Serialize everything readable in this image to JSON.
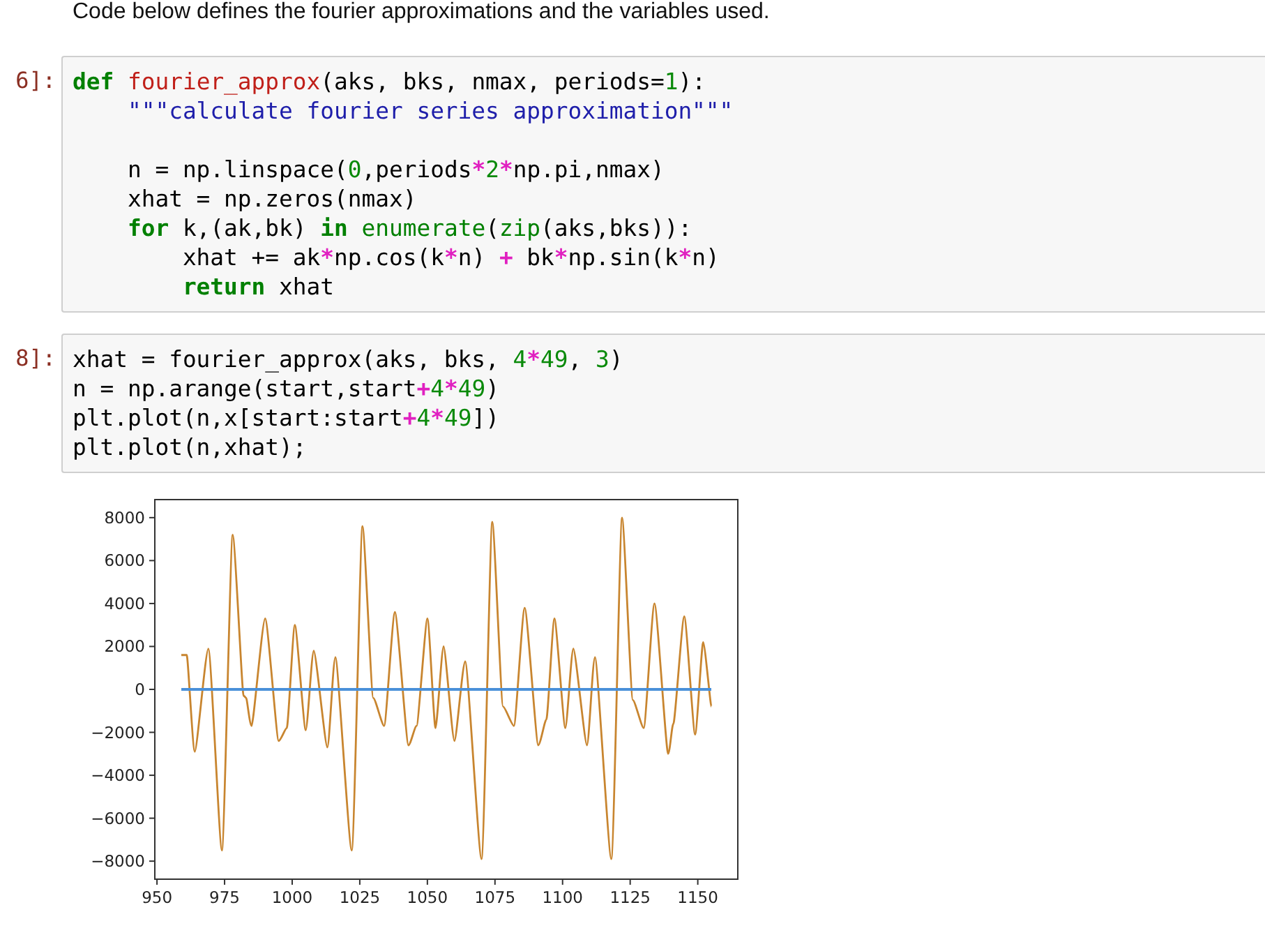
{
  "intro": "Code below defines the fourier approximations and the variables used.",
  "cells": [
    {
      "prompt": "6]:",
      "lines": [
        {
          "tokens": [
            {
              "kind": "kw",
              "text": "def "
            },
            {
              "kind": "fn",
              "text": "fourier_approx"
            },
            {
              "kind": "plain",
              "text": "(aks, bks, nmax, periods="
            },
            {
              "kind": "num",
              "text": "1"
            },
            {
              "kind": "plain",
              "text": "):"
            }
          ]
        },
        {
          "tokens": [
            {
              "kind": "str",
              "text": "    \"\"\"calculate fourier series approximation\"\"\""
            }
          ]
        },
        {
          "kind": "blank"
        },
        {
          "tokens": [
            {
              "kind": "plain",
              "text": "    n = np.linspace("
            },
            {
              "kind": "num",
              "text": "0"
            },
            {
              "kind": "plain",
              "text": ",periods"
            },
            {
              "kind": "op",
              "text": "*"
            },
            {
              "kind": "num",
              "text": "2"
            },
            {
              "kind": "op",
              "text": "*"
            },
            {
              "kind": "plain",
              "text": "np.pi,nmax)"
            }
          ]
        },
        {
          "tokens": [
            {
              "kind": "plain",
              "text": "    xhat = np.zeros(nmax)"
            }
          ]
        },
        {
          "tokens": [
            {
              "kind": "kw",
              "text": "    for"
            },
            {
              "kind": "plain",
              "text": " k,(ak,bk) "
            },
            {
              "kind": "kw",
              "text": "in "
            },
            {
              "kind": "builtin",
              "text": "enumerate"
            },
            {
              "kind": "plain",
              "text": "("
            },
            {
              "kind": "builtin",
              "text": "zip"
            },
            {
              "kind": "plain",
              "text": "(aks,bks)):"
            }
          ]
        },
        {
          "tokens": [
            {
              "kind": "plain",
              "text": "        xhat += ak"
            },
            {
              "kind": "op",
              "text": "*"
            },
            {
              "kind": "plain",
              "text": "np.cos(k"
            },
            {
              "kind": "op",
              "text": "*"
            },
            {
              "kind": "plain",
              "text": "n) "
            },
            {
              "kind": "op",
              "text": "+"
            },
            {
              "kind": "plain",
              "text": " bk"
            },
            {
              "kind": "op",
              "text": "*"
            },
            {
              "kind": "plain",
              "text": "np.sin(k"
            },
            {
              "kind": "op",
              "text": "*"
            },
            {
              "kind": "plain",
              "text": "n)"
            }
          ]
        },
        {
          "tokens": [
            {
              "kind": "kw",
              "text": "        return"
            },
            {
              "kind": "plain",
              "text": " xhat"
            }
          ]
        }
      ]
    },
    {
      "prompt": "8]:",
      "lines": [
        {
          "tokens": [
            {
              "kind": "plain",
              "text": "xhat = fourier_approx(aks, bks, "
            },
            {
              "kind": "num",
              "text": "4"
            },
            {
              "kind": "op",
              "text": "*"
            },
            {
              "kind": "num",
              "text": "49"
            },
            {
              "kind": "plain",
              "text": ", "
            },
            {
              "kind": "num",
              "text": "3"
            },
            {
              "kind": "plain",
              "text": ")"
            }
          ]
        },
        {
          "tokens": [
            {
              "kind": "plain",
              "text": "n = np.arange(start,start"
            },
            {
              "kind": "op",
              "text": "+"
            },
            {
              "kind": "num",
              "text": "4"
            },
            {
              "kind": "op",
              "text": "*"
            },
            {
              "kind": "num",
              "text": "49"
            },
            {
              "kind": "plain",
              "text": ")"
            }
          ]
        },
        {
          "tokens": [
            {
              "kind": "plain",
              "text": "plt.plot(n,x[start:start"
            },
            {
              "kind": "op",
              "text": "+"
            },
            {
              "kind": "num",
              "text": "4"
            },
            {
              "kind": "op",
              "text": "*"
            },
            {
              "kind": "num",
              "text": "49"
            },
            {
              "kind": "plain",
              "text": "])"
            }
          ]
        },
        {
          "tokens": [
            {
              "kind": "plain",
              "text": "plt.plot(n,xhat);"
            }
          ]
        }
      ]
    }
  ],
  "output": {
    "chart_data": {
      "type": "line",
      "x": [
        959,
        961,
        964,
        969,
        974,
        978,
        982,
        983,
        985,
        990,
        995,
        998,
        1001,
        1005,
        1008,
        1013,
        1016,
        1022,
        1026,
        1030,
        1034,
        1038,
        1043,
        1046,
        1050,
        1053,
        1056,
        1060,
        1064,
        1070,
        1074,
        1078,
        1082,
        1086,
        1091,
        1094,
        1097,
        1101,
        1104,
        1109,
        1112,
        1118,
        1122,
        1126,
        1130,
        1134,
        1139,
        1141,
        1145,
        1149,
        1152,
        1155
      ],
      "series": [
        {
          "color": "#c8852f",
          "values": [
            1600,
            1600,
            -2900,
            1900,
            -7500,
            7200,
            -300,
            -400,
            -1700,
            3300,
            -2400,
            -1800,
            3000,
            -1900,
            1800,
            -2700,
            1500,
            -7500,
            7600,
            -400,
            -1700,
            3600,
            -2600,
            -1700,
            3300,
            -1800,
            2000,
            -2400,
            1300,
            -7900,
            7800,
            -800,
            -1700,
            3800,
            -2600,
            -1400,
            3300,
            -1800,
            1900,
            -2600,
            1500,
            -7900,
            8000,
            -500,
            -1800,
            4000,
            -3000,
            -1600,
            3400,
            -2100,
            2200,
            -800
          ]
        },
        {
          "color": "#4a90d9",
          "values": [
            0,
            0,
            0,
            0,
            0,
            0,
            0,
            0,
            0,
            0,
            0,
            0,
            0,
            0,
            0,
            0,
            0,
            0,
            0,
            0,
            0,
            0,
            0,
            0,
            0,
            0,
            0,
            0,
            0,
            0,
            0,
            0,
            0,
            0,
            0,
            0,
            0,
            0,
            0,
            0,
            0,
            0,
            0,
            0,
            0,
            0,
            0,
            0,
            0,
            0,
            0,
            0
          ]
        }
      ],
      "xlim": [
        949.2,
        1164.8
      ],
      "ylim": [
        -8840,
        8840
      ],
      "xticks": [
        950,
        975,
        1000,
        1025,
        1050,
        1075,
        1100,
        1125,
        1150
      ],
      "yticks": [
        {
          "value": 8000,
          "label": "8000"
        },
        {
          "value": 6000,
          "label": "6000"
        },
        {
          "value": 4000,
          "label": "4000"
        },
        {
          "value": 2000,
          "label": "2000"
        },
        {
          "value": 0,
          "label": "0"
        },
        {
          "value": -2000,
          "label": "−2000"
        },
        {
          "value": -4000,
          "label": "−4000"
        },
        {
          "value": -6000,
          "label": "−6000"
        },
        {
          "value": -8000,
          "label": "−8000"
        }
      ]
    }
  }
}
